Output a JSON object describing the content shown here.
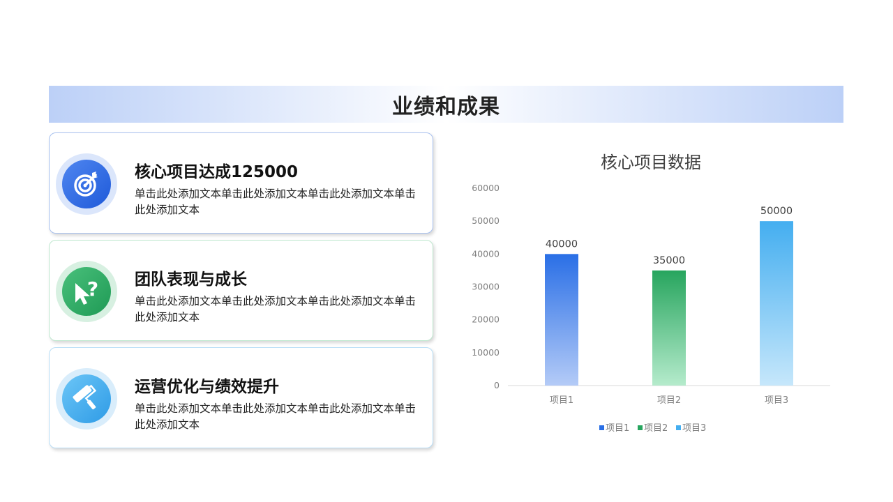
{
  "page_title": "业绩和成果",
  "cards": [
    {
      "title": "核心项目达成125000",
      "desc": "单击此处添加文本单击此处添加文本单击此处添加文本单击此处添加文本",
      "icon": "target-icon"
    },
    {
      "title": "团队表现与成长",
      "desc": "单击此处添加文本单击此处添加文本单击此处添加文本单击此处添加文本",
      "icon": "cursor-question-icon"
    },
    {
      "title": "运营优化与绩效提升",
      "desc": "单击此处添加文本单击此处添加文本单击此处添加文本单击此处添加文本",
      "icon": "paint-roller-icon"
    }
  ],
  "colors": {
    "series1_top": "#2a6fe6",
    "series1_bottom": "#b4cbf7",
    "series2_top": "#27a55e",
    "series2_bottom": "#b5ebcc",
    "series3_top": "#44aef0",
    "series3_bottom": "#c6e7fb"
  },
  "chart_data": {
    "type": "bar",
    "title": "核心项目数据",
    "categories": [
      "项目1",
      "项目2",
      "项目3"
    ],
    "values": [
      40000,
      35000,
      50000
    ],
    "data_labels": [
      "40000",
      "35000",
      "50000"
    ],
    "legend": [
      "项目1",
      "项目2",
      "项目3"
    ],
    "legend_position": "bottom",
    "ylim": [
      0,
      60000
    ],
    "yticks": [
      0,
      10000,
      20000,
      30000,
      40000,
      50000,
      60000
    ],
    "grid": false,
    "xlabel": "",
    "ylabel": ""
  }
}
